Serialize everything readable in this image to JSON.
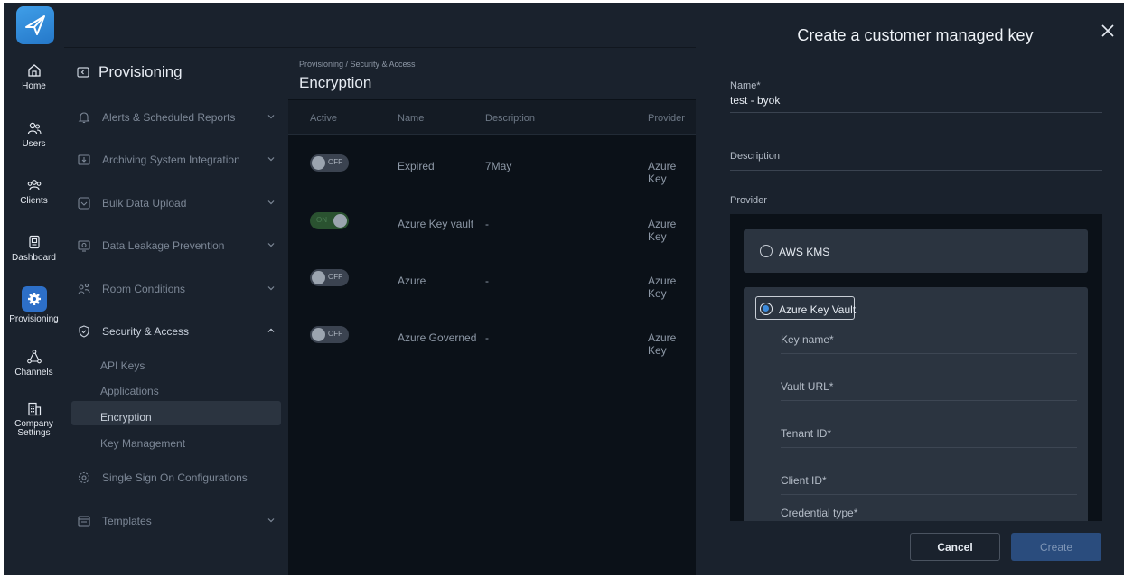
{
  "rail": {
    "items": [
      {
        "label": "Home",
        "icon": "home-icon"
      },
      {
        "label": "Users",
        "icon": "users-icon"
      },
      {
        "label": "Clients",
        "icon": "clients-icon"
      },
      {
        "label": "Dashboard",
        "icon": "dashboard-icon"
      },
      {
        "label": "Provisioning",
        "icon": "gear-icon",
        "active": true
      },
      {
        "label": "Channels",
        "icon": "channels-icon"
      },
      {
        "label": "Company Settings",
        "icon": "building-icon"
      }
    ]
  },
  "nav": {
    "title": "Provisioning",
    "items": [
      {
        "label": "Alerts & Scheduled Reports",
        "icon": "bell-icon"
      },
      {
        "label": "Archiving System Integration",
        "icon": "archive-icon"
      },
      {
        "label": "Bulk Data Upload",
        "icon": "upload-icon"
      },
      {
        "label": "Data Leakage Prevention",
        "icon": "dlp-icon"
      },
      {
        "label": "Room Conditions",
        "icon": "room-icon"
      },
      {
        "label": "Security & Access",
        "icon": "shield-icon"
      },
      {
        "label": "Single Sign On Configurations",
        "icon": "sso-icon"
      },
      {
        "label": "Templates",
        "icon": "template-icon"
      }
    ],
    "sub_items": [
      "API Keys",
      "Applications",
      "Encryption",
      "Key Management"
    ]
  },
  "content": {
    "breadcrumb": "Provisioning / Security & Access",
    "title": "Encryption",
    "columns": [
      "Active",
      "Name",
      "Description",
      "Provider"
    ],
    "rows": [
      {
        "active": "OFF",
        "name": "Expired",
        "description": "7May",
        "provider": "Azure Key"
      },
      {
        "active": "ON",
        "name": "Azure Key vault",
        "description": "-",
        "provider": "Azure Key"
      },
      {
        "active": "OFF",
        "name": "Azure",
        "description": "-",
        "provider": "Azure Key"
      },
      {
        "active": "OFF",
        "name": "Azure Governed",
        "description": "-",
        "provider": "Azure Key"
      }
    ]
  },
  "drawer": {
    "title": "Create a customer managed key",
    "name_label": "Name*",
    "name_value": "test - byok",
    "description_label": "Description",
    "provider_label": "Provider",
    "options": {
      "aws": "AWS KMS",
      "azure": "Azure Key Vault"
    },
    "azure_fields": [
      "Key name*",
      "Vault URL*",
      "Tenant ID*",
      "Client ID*",
      "Credential type*"
    ],
    "cancel_label": "Cancel",
    "create_label": "Create"
  }
}
